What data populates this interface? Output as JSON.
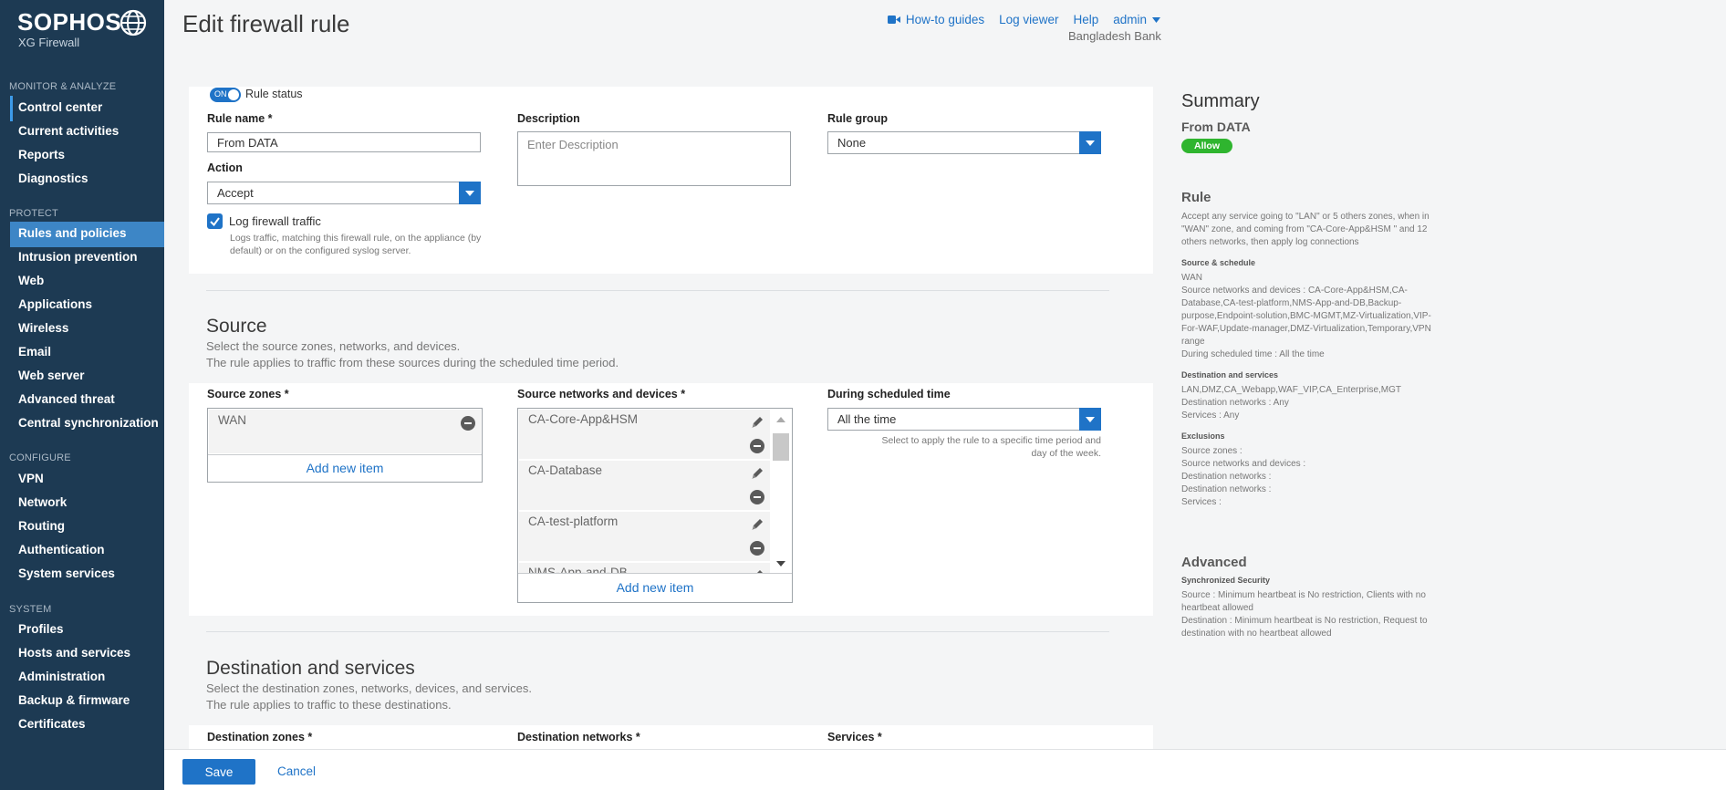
{
  "brand": {
    "name": "SOPHOS",
    "product": "XG Firewall"
  },
  "nav": {
    "monitor_title": "MONITOR & ANALYZE",
    "monitor": [
      "Control center",
      "Current activities",
      "Reports",
      "Diagnostics"
    ],
    "protect_title": "PROTECT",
    "protect": [
      "Rules and policies",
      "Intrusion prevention",
      "Web",
      "Applications",
      "Wireless",
      "Email",
      "Web server",
      "Advanced threat",
      "Central synchronization"
    ],
    "configure_title": "CONFIGURE",
    "configure": [
      "VPN",
      "Network",
      "Routing",
      "Authentication",
      "System services"
    ],
    "system_title": "SYSTEM",
    "system": [
      "Profiles",
      "Hosts and services",
      "Administration",
      "Backup & firmware",
      "Certificates"
    ]
  },
  "header": {
    "title": "Edit firewall rule",
    "links": {
      "guides": "How-to guides",
      "log_viewer": "Log viewer",
      "help": "Help",
      "user": "admin"
    },
    "org": "Bangladesh Bank"
  },
  "rule": {
    "toggle": "ON",
    "status_label": "Rule status",
    "name_label": "Rule name *",
    "name_value": "From DATA",
    "description_label": "Description",
    "description_placeholder": "Enter Description",
    "group_label": "Rule group",
    "group_value": "None",
    "action_label": "Action",
    "action_value": "Accept",
    "log_label": "Log firewall traffic",
    "log_checked": true,
    "log_help": "Logs traffic, matching this firewall rule, on the appliance (by default) or on the configured syslog server."
  },
  "source": {
    "title": "Source",
    "desc1": "Select the source zones, networks, and devices.",
    "desc2": "The rule applies to traffic from these sources during the scheduled time period.",
    "zones_label": "Source zones *",
    "zones": [
      "WAN"
    ],
    "networks_label": "Source networks and devices *",
    "networks": [
      "CA-Core-App&HSM",
      "CA-Database",
      "CA-test-platform",
      "NMS-App-and-DB"
    ],
    "add_new": "Add new item",
    "schedule_label": "During scheduled time",
    "schedule_value": "All the time",
    "schedule_help": "Select to apply the rule to a specific time period and day of the week."
  },
  "destination": {
    "title": "Destination and services",
    "desc1": "Select the destination zones, networks, devices, and services.",
    "desc2": "The rule applies to traffic to these destinations.",
    "zones_label": "Destination zones *",
    "networks_label": "Destination networks *",
    "services_label": "Services *"
  },
  "summary": {
    "title": "Summary",
    "name": "From DATA",
    "badge": "Allow",
    "rule_heading": "Rule",
    "rule_text": "Accept any service going to \"LAN\" or 5 others zones, when in \"WAN\" zone, and coming from \"CA-Core-App&HSM \" and 12 others networks, then apply log connections",
    "src_heading": "Source & schedule",
    "src_zone": "WAN",
    "src_networks": "Source networks and devices : CA-Core-App&HSM,CA-Database,CA-test-platform,NMS-App-and-DB,Backup-purpose,Endpoint-solution,BMC-MGMT,MZ-Virtualization,VIP-For-WAF,Update-manager,DMZ-Virtualization,Temporary,VPN range",
    "src_schedule": "During scheduled time : All the time",
    "dst_heading": "Destination and services",
    "dst_zones": "LAN,DMZ,CA_Webapp,WAF_VIP,CA_Enterprise,MGT",
    "dst_networks": "Destination networks : Any",
    "dst_services": "Services : Any",
    "excl_heading": "Exclusions",
    "excl_lines": [
      "Source zones :",
      "Source networks and devices :",
      "Destination networks :",
      "Destination networks :",
      "Services :"
    ],
    "adv_heading": "Advanced",
    "sync_heading": "Synchronized Security",
    "sync_source": "Source : Minimum heartbeat is No restriction, Clients with no heartbeat allowed",
    "sync_dest": "Destination : Minimum heartbeat is No restriction, Request to destination with no heartbeat allowed"
  },
  "footer": {
    "save": "Save",
    "cancel": "Cancel"
  },
  "colors": {
    "sidebar": "#1d3a53",
    "accent": "#1f73c7",
    "active_nav": "#3d86c6",
    "allow": "#2fb52f"
  }
}
